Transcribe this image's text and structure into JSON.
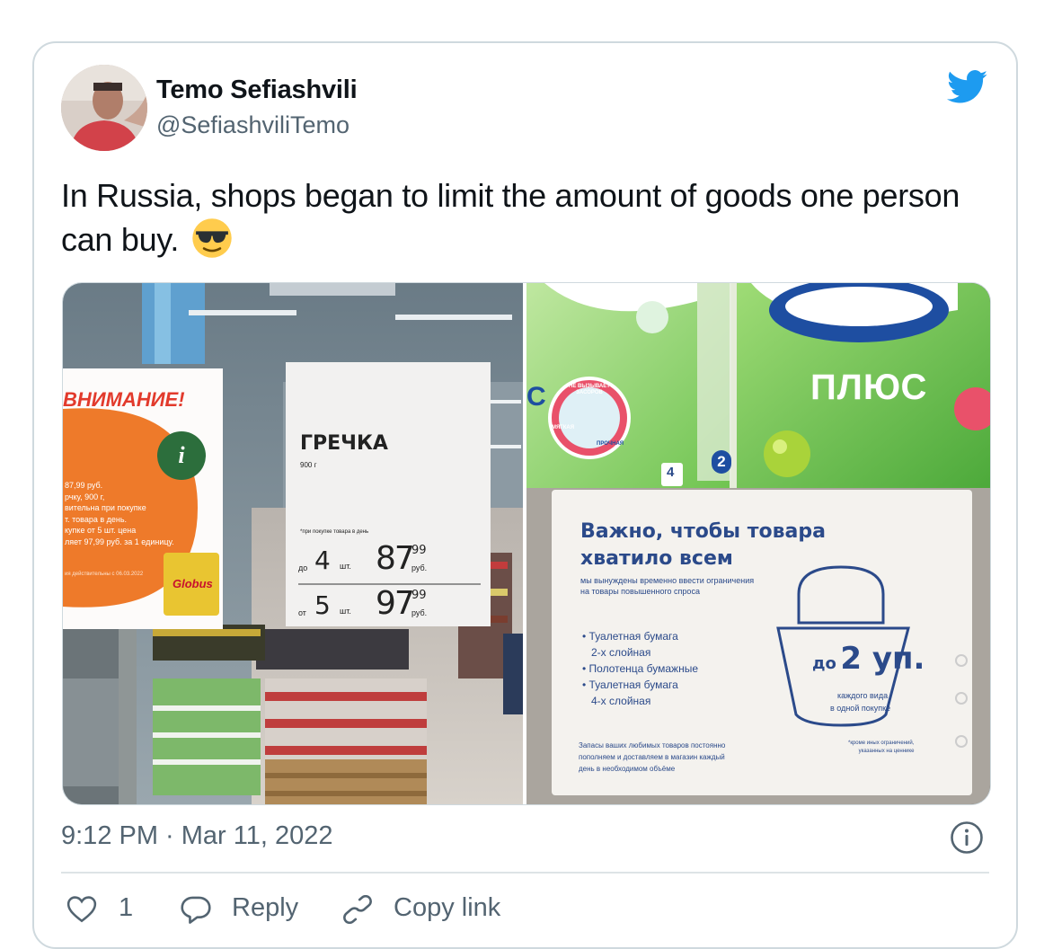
{
  "tweet": {
    "author_name": "Temo Sefiashvili",
    "author_handle": "@SefiashviliTemo",
    "text": "In Russia, shops began to limit the amount of goods one person can buy.",
    "timestamp": "9:12 PM · Mar 11, 2022"
  },
  "icons": {
    "brand": "twitter-bird-icon",
    "emoji": "sunglasses-emoji-icon",
    "info": "info-icon",
    "like": "heart-icon",
    "reply": "reply-bubble-icon",
    "copy": "link-icon"
  },
  "colors": {
    "brand": "#1d9bf0",
    "secondary_text": "#536471",
    "border": "#cfd9de"
  },
  "photo_left": {
    "warning_header": "ВНИМАНИЕ!",
    "warning_lines": [
      "87,99 руб.",
      "рчку, 900 г,",
      "вительна при покупке",
      "т. товара в день.",
      "купке от 5 шт. цена",
      "ляет 97,99 руб. за 1 единицу."
    ],
    "warning_footer": "ия действительны с 06.03.2022",
    "store_logo": "Globus",
    "product_name": "ГРЕЧКА",
    "product_weight": "900 г",
    "condition_note": "*при покупке товара в день",
    "tier1_prefix": "до",
    "tier1_qty": "4",
    "tier1_unit": "шт.",
    "tier1_price_main": "87",
    "tier1_price_cents": "99",
    "tier1_currency": "руб.",
    "tier2_prefix": "от",
    "tier2_qty": "5",
    "tier2_unit": "шт.",
    "tier2_price_main": "97",
    "tier2_price_cents": "99",
    "tier2_currency": "руб."
  },
  "photo_right": {
    "brand_left": "С",
    "brand_right": "ПЛЮС",
    "badge_top": "НЕ ВЫЗЫВАЕТ ЗАСОРОВ",
    "badge_soft": "МЯГКАЯ",
    "badge_strong": "ПРОЧНАЯ",
    "layers_left": "4",
    "layers_right": "2",
    "sign_title_1": "Важно, чтобы товара",
    "sign_title_2": "хватило всем",
    "sign_sub_1": "мы вынуждены временно ввести ограничения",
    "sign_sub_2": "на товары повышенного спроса",
    "items": [
      "• Туалетная бумага",
      "2-х слойная",
      "• Полотенца бумажные",
      "• Туалетная бумага",
      "4-х слойная"
    ],
    "limit_prefix": "до",
    "limit_value": "2 уп.",
    "limit_note_1": "каждого вида",
    "limit_note_2": "в одной покупке",
    "footer_1": "Запасы ваших любимых товаров постоянно",
    "footer_2": "пополняем и доставляем в магазин каждый",
    "footer_3": "день в необходимом объёме",
    "fine_print_1": "*кроме иных ограничений,",
    "fine_print_2": "указанных на ценнике"
  },
  "actions": {
    "like_count": "1",
    "reply_label": "Reply",
    "copy_label": "Copy link"
  }
}
